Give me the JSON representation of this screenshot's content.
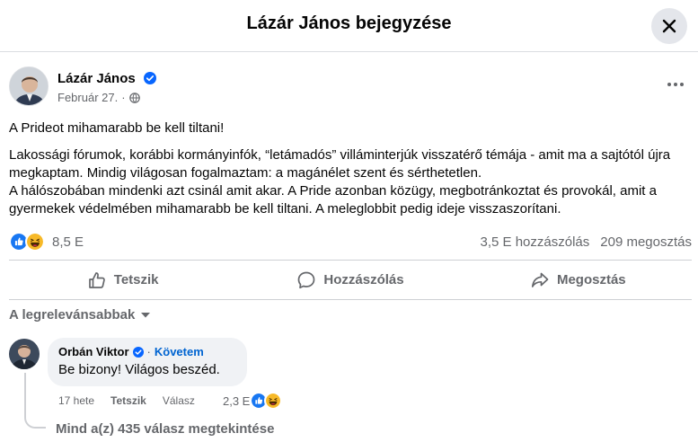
{
  "header": {
    "title": "Lázár János bejegyzése",
    "close_icon": "close-icon"
  },
  "post": {
    "author": "Lázár János",
    "date": "Február 27.",
    "separator": "·",
    "privacy_icon": "globe-icon",
    "title_line": "A Prideot mihamarabb be kell tiltani!",
    "paragraph": "Lakossági fórumok, korábbi kormányinfók, “letámadós” villáminterjúk visszatérő témája - amit ma a sajtótól újra megkaptam. Mindig világosan fogalmaztam: a magánélet szent és sérthetetlen.",
    "paragraph2": "A hálószobában mindenki azt csinál amit akar. A Pride azonban közügy, megbotránkoztat és provokál, amit a gyermekek védelmében mihamarabb be kell tiltani. A meleglobbit pedig ideje visszaszorítani."
  },
  "stats": {
    "reactions": "8,5 E",
    "comments": "3,5 E hozzászólás",
    "shares": "209 megosztás"
  },
  "actions": {
    "like": "Tetszik",
    "comment": "Hozzászólás",
    "share": "Megosztás"
  },
  "sort": {
    "label": "A legrelevánsabbak"
  },
  "comment": {
    "author": "Orbán Viktor",
    "separator": "·",
    "follow": "Követem",
    "text": "Be bizony! Világos beszéd.",
    "time": "17 hete",
    "like": "Tetszik",
    "reply": "Válasz",
    "reactions": "2,3 E"
  },
  "replies": {
    "label": "Mind a(z) 435 válasz megtekintése"
  },
  "colors": {
    "brand": "#0866ff",
    "verified": "#0866ff",
    "follow": "#0064d1",
    "muted": "#65676b"
  }
}
